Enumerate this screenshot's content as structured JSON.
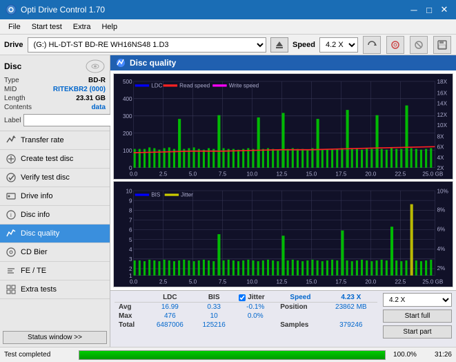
{
  "titlebar": {
    "title": "Opti Drive Control 1.70",
    "minimize": "─",
    "maximize": "□",
    "close": "✕"
  },
  "menubar": {
    "items": [
      "File",
      "Start test",
      "Extra",
      "Help"
    ]
  },
  "drivebar": {
    "label": "Drive",
    "drive_value": "(G:) HL-DT-ST BD-RE  WH16NS48 1.D3",
    "speed_label": "Speed",
    "speed_value": "4.2 X"
  },
  "disc": {
    "title": "Disc",
    "type_label": "Type",
    "type_value": "BD-R",
    "mid_label": "MID",
    "mid_value": "RITEKBR2 (000)",
    "length_label": "Length",
    "length_value": "23.31 GB",
    "contents_label": "Contents",
    "contents_value": "data",
    "label_label": "Label",
    "label_value": ""
  },
  "nav": {
    "items": [
      {
        "id": "transfer-rate",
        "label": "Transfer rate",
        "active": false
      },
      {
        "id": "create-test-disc",
        "label": "Create test disc",
        "active": false
      },
      {
        "id": "verify-test-disc",
        "label": "Verify test disc",
        "active": false
      },
      {
        "id": "drive-info",
        "label": "Drive info",
        "active": false
      },
      {
        "id": "disc-info",
        "label": "Disc info",
        "active": false
      },
      {
        "id": "disc-quality",
        "label": "Disc quality",
        "active": true
      },
      {
        "id": "cd-bier",
        "label": "CD Bier",
        "active": false
      },
      {
        "id": "fe-te",
        "label": "FE / TE",
        "active": false
      },
      {
        "id": "extra-tests",
        "label": "Extra tests",
        "active": false
      }
    ]
  },
  "status_btn": "Status window >>",
  "chart_title": "Disc quality",
  "chart_top": {
    "legend": [
      {
        "label": "LDC",
        "color": "#0000ff"
      },
      {
        "label": "Read speed",
        "color": "#ff0000"
      },
      {
        "label": "Write speed",
        "color": "#ff00ff"
      }
    ],
    "y_left": [
      "500",
      "400",
      "300",
      "200",
      "100",
      "0"
    ],
    "y_right": [
      "18X",
      "16X",
      "14X",
      "12X",
      "10X",
      "8X",
      "6X",
      "4X",
      "2X"
    ],
    "x_labels": [
      "0.0",
      "2.5",
      "5.0",
      "7.5",
      "10.0",
      "12.5",
      "15.0",
      "17.5",
      "20.0",
      "22.5",
      "25.0 GB"
    ]
  },
  "chart_bottom": {
    "legend": [
      {
        "label": "BIS",
        "color": "#0000ff"
      },
      {
        "label": "Jitter",
        "color": "#ffff00"
      }
    ],
    "y_left": [
      "10",
      "9",
      "8",
      "7",
      "6",
      "5",
      "4",
      "3",
      "2",
      "1"
    ],
    "y_right": [
      "10%",
      "8%",
      "6%",
      "4%",
      "2%"
    ],
    "x_labels": [
      "0.0",
      "2.5",
      "5.0",
      "7.5",
      "10.0",
      "12.5",
      "15.0",
      "17.5",
      "20.0",
      "22.5",
      "25.0 GB"
    ]
  },
  "stats": {
    "headers": [
      "",
      "LDC",
      "BIS",
      "",
      "Jitter",
      "Speed",
      ""
    ],
    "rows": [
      {
        "label": "Avg",
        "ldc": "16.99",
        "bis": "0.33",
        "jitter": "-0.1%",
        "speed_label": "Position",
        "speed_val": "23862 MB"
      },
      {
        "label": "Max",
        "ldc": "476",
        "bis": "10",
        "jitter": "0.0%"
      },
      {
        "label": "Total",
        "ldc": "6487006",
        "bis": "125216",
        "jitter": "",
        "speed_label": "Samples",
        "speed_val": "379246"
      }
    ],
    "jitter_checked": true,
    "speed_display": "4.23 X",
    "speed_select": "4.2 X",
    "start_full_label": "Start full",
    "start_part_label": "Start part"
  },
  "progress": {
    "status": "Test completed",
    "percent": "100.0%",
    "time": "31:26"
  }
}
